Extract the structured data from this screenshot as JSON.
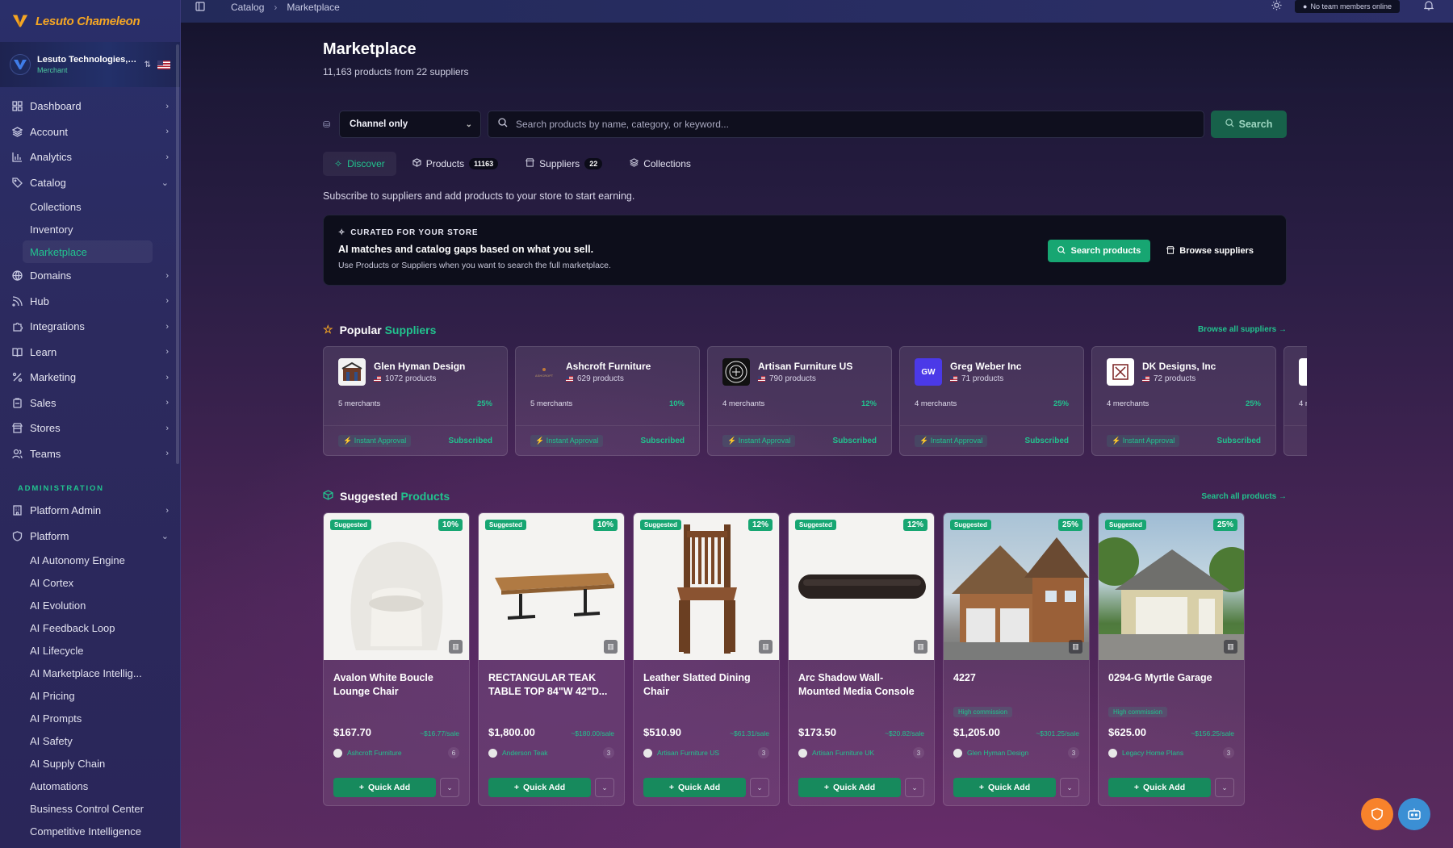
{
  "brand": {
    "name": "Lesuto Chameleon"
  },
  "org": {
    "name": "Lesuto Technologies, I...",
    "role": "Merchant"
  },
  "topbar": {
    "crumb1": "Catalog",
    "crumb2": "Marketplace",
    "status": "No team members online"
  },
  "nav": {
    "items": [
      {
        "label": "Dashboard"
      },
      {
        "label": "Account"
      },
      {
        "label": "Analytics"
      },
      {
        "label": "Catalog"
      },
      {
        "label": "Domains"
      },
      {
        "label": "Hub"
      },
      {
        "label": "Integrations"
      },
      {
        "label": "Learn"
      },
      {
        "label": "Marketing"
      },
      {
        "label": "Sales"
      },
      {
        "label": "Stores"
      },
      {
        "label": "Teams"
      }
    ],
    "catalog_sub": [
      "Collections",
      "Inventory",
      "Marketplace"
    ],
    "admin_label": "ADMINISTRATION",
    "admin_items": [
      {
        "label": "Platform Admin"
      },
      {
        "label": "Platform"
      }
    ],
    "platform_sub": [
      "AI Autonomy Engine",
      "AI Cortex",
      "AI Evolution",
      "AI Feedback Loop",
      "AI Lifecycle",
      "AI Marketplace Intellig...",
      "AI Pricing",
      "AI Prompts",
      "AI Safety",
      "AI Supply Chain",
      "Automations",
      "Business Control Center",
      "Competitive Intelligence"
    ]
  },
  "page": {
    "title": "Marketplace",
    "subtitle": "11,163 products from 22 suppliers"
  },
  "search": {
    "channel": "Channel only",
    "placeholder": "Search products by name, category, or keyword...",
    "button": "Search"
  },
  "tabs": [
    {
      "label": "Discover"
    },
    {
      "label": "Products",
      "badge": "11163"
    },
    {
      "label": "Suppliers",
      "badge": "22"
    },
    {
      "label": "Collections"
    }
  ],
  "intro": "Subscribe to suppliers and add products to your store to start earning.",
  "curated": {
    "label": "CURATED FOR YOUR STORE",
    "title": "AI matches and catalog gaps based on what you sell.",
    "sub": "Use Products or Suppliers when you want to search the full marketplace.",
    "btn_search": "Search products",
    "btn_browse": "Browse suppliers"
  },
  "popular": {
    "title_a": "Popular",
    "title_b": "Suppliers",
    "link": "Browse all suppliers →"
  },
  "suppliers": [
    {
      "name": "Glen Hyman Design",
      "products": "1072 products",
      "merchants": "5 merchants",
      "pct": "25%",
      "instant": "Instant Approval",
      "status": "Subscribed",
      "logo_bg": "#f3f3f3"
    },
    {
      "name": "Ashcroft Furniture",
      "products": "629 products",
      "merchants": "5 merchants",
      "pct": "10%",
      "instant": "Instant Approval",
      "status": "Subscribed",
      "logo_bg": "transparent"
    },
    {
      "name": "Artisan Furniture US",
      "products": "790 products",
      "merchants": "4 merchants",
      "pct": "12%",
      "instant": "Instant Approval",
      "status": "Subscribed",
      "logo_bg": "#111111"
    },
    {
      "name": "Greg Weber Inc",
      "products": "71 products",
      "merchants": "4 merchants",
      "pct": "25%",
      "instant": "Instant Approval",
      "status": "Subscribed",
      "logo_bg": "#4b39e8",
      "logo_text": "GW"
    },
    {
      "name": "DK Designs, Inc",
      "products": "72 products",
      "merchants": "4 merchants",
      "pct": "25%",
      "instant": "Instant Approval",
      "status": "Subscribed",
      "logo_bg": "#ffffff"
    },
    {
      "name": "",
      "products": "",
      "merchants": "4 m",
      "pct": "",
      "instant": "",
      "status": "",
      "logo_bg": "#ffffff"
    }
  ],
  "suggested": {
    "title_a": "Suggested",
    "title_b": "Products",
    "link": "Search all products →"
  },
  "products": [
    {
      "tag": "Suggested",
      "pct": "10%",
      "name": "Avalon White Boucle Lounge Chair",
      "high": "",
      "price": "$167.70",
      "per": "~$16.77/sale",
      "seller": "Ashcroft Furniture",
      "count": "6",
      "btn": "Quick Add"
    },
    {
      "tag": "Suggested",
      "pct": "10%",
      "name": "RECTANGULAR TEAK TABLE TOP 84\"W 42\"D...",
      "high": "",
      "price": "$1,800.00",
      "per": "~$180.00/sale",
      "seller": "Anderson Teak",
      "count": "3",
      "btn": "Quick Add"
    },
    {
      "tag": "Suggested",
      "pct": "12%",
      "name": "Leather Slatted Dining Chair",
      "high": "",
      "price": "$510.90",
      "per": "~$61.31/sale",
      "seller": "Artisan Furniture US",
      "count": "3",
      "btn": "Quick Add"
    },
    {
      "tag": "Suggested",
      "pct": "12%",
      "name": "Arc Shadow Wall-Mounted Media Console",
      "high": "",
      "price": "$173.50",
      "per": "~$20.82/sale",
      "seller": "Artisan Furniture UK",
      "count": "3",
      "btn": "Quick Add"
    },
    {
      "tag": "Suggested",
      "pct": "25%",
      "name": "4227",
      "high": "High commission",
      "price": "$1,205.00",
      "per": "~$301.25/sale",
      "seller": "Glen Hyman Design",
      "count": "3",
      "btn": "Quick Add"
    },
    {
      "tag": "Suggested",
      "pct": "25%",
      "name": "0294-G Myrtle Garage",
      "high": "High commission",
      "price": "$625.00",
      "per": "~$156.25/sale",
      "seller": "Legacy Home Plans",
      "count": "3",
      "btn": "Quick Add"
    }
  ],
  "colors": {
    "accent": "#22c38e",
    "brand": "#f5a623",
    "fab_orange": "#f7822b",
    "fab_blue": "#3b8fd4"
  }
}
